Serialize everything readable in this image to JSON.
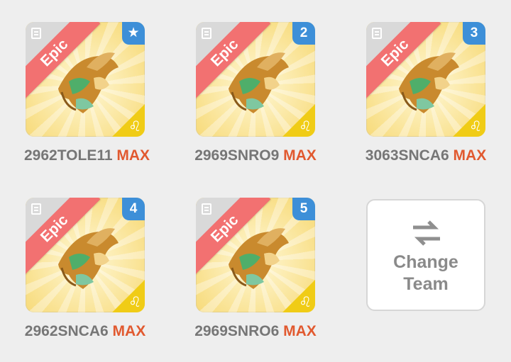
{
  "colors": {
    "background": "#eeeeee",
    "ribbon": "#f27171",
    "badge": "#3d8fd8",
    "zodiac": "#f0cc16",
    "max": "#e1592f",
    "code": "#767676"
  },
  "cards": [
    {
      "rarity": "Epic",
      "badge": "★",
      "badge_icon": "star-icon",
      "code": "2962TOLE11",
      "level": "MAX",
      "zodiac": "♌"
    },
    {
      "rarity": "Epic",
      "badge": "2",
      "code": "2969SNRO9",
      "level": "MAX",
      "zodiac": "♌"
    },
    {
      "rarity": "Epic",
      "badge": "3",
      "code": "3063SNCA6",
      "level": "MAX",
      "zodiac": "♌"
    },
    {
      "rarity": "Epic",
      "badge": "4",
      "code": "2962SNCA6",
      "level": "MAX",
      "zodiac": "♌"
    },
    {
      "rarity": "Epic",
      "badge": "5",
      "code": "2969SNRO6",
      "level": "MAX",
      "zodiac": "♌"
    }
  ],
  "change_team": {
    "line1": "Change",
    "line2": "Team",
    "icon": "swap-arrows-icon"
  }
}
